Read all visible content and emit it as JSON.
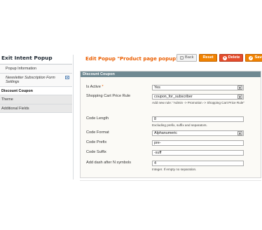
{
  "sidebar": {
    "title": "Exit Intent Popup",
    "items": [
      {
        "label": "Popup Information"
      },
      {
        "label": "Newsletter Subscription Form Settings"
      },
      {
        "label": "Discount Coupon"
      },
      {
        "label": "Theme"
      },
      {
        "label": "Additional Fields"
      }
    ]
  },
  "header": {
    "title": "Edit Popup \"Product page popup\"",
    "buttons": {
      "back": "Back",
      "reset": "Reset",
      "delete": "Delete",
      "save": "Save"
    }
  },
  "form": {
    "legend": "Discount Coupon",
    "is_active": {
      "label": "Is Active",
      "required_mark": "*",
      "value": "Yes"
    },
    "price_rule": {
      "label": "Shopping Cart Price Rule",
      "value": "coupon_for_subscriber",
      "note": "Add new rule: \"Admin -> Promotion -> Shopping Cart Price Rule\""
    },
    "code_length": {
      "label": "Code Length",
      "value": "8",
      "note": "Excluding prefix, suffix and separators."
    },
    "code_format": {
      "label": "Code Format",
      "value": "Alphanumeric"
    },
    "code_prefix": {
      "label": "Code Prefix",
      "value": "pre-"
    },
    "code_suffix": {
      "label": "Code Suffix",
      "value": "-suff"
    },
    "dash_after": {
      "label": "Add dash after N symbols",
      "value": "4",
      "note": "Integer. If empty no separation."
    }
  },
  "colors": {
    "accent": "#eb5e00",
    "button_orange": "#f18200",
    "button_delete": "#e44c2b",
    "legend_bg": "#6f8992"
  }
}
